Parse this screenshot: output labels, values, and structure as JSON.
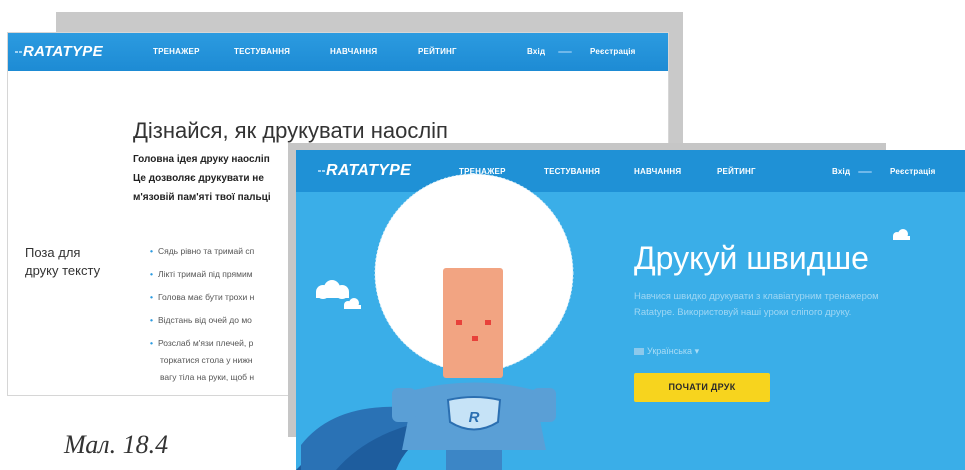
{
  "nav": {
    "logo": "RATATYPE",
    "items": [
      "ТРЕНАЖЕР",
      "ТЕСТУВАННЯ",
      "НАВЧАННЯ",
      "РЕЙТИНГ"
    ],
    "login": "Вхід",
    "register": "Реєстрація"
  },
  "back_page": {
    "title": "Дізнайся, як друкувати наосліп",
    "paragraph": [
      "Головна ідея друку наосліп",
      "Це дозволяє друкувати не",
      "м'язовій пам'яті твої пальці"
    ],
    "section_title": [
      "Поза для",
      "друку тексту"
    ],
    "bullets": [
      "Сядь рівно та тримай сп",
      "Лікті тримай під прямим",
      "Голова має бути трохи н",
      "Відстань від очей до мо",
      "Розслаб м'язи плечей, р"
    ],
    "bullet_continuation": [
      "торкатися стола у нижн",
      "вагу тіла на руки, щоб н"
    ]
  },
  "front_page": {
    "hero_title": "Друкуй швидше",
    "hero_subtitle": [
      "Навчися швидко друкувати з клавіатурним тренажером",
      "Ratatype. Використовуй наші уроки сліпого друку."
    ],
    "language": "Українська",
    "start_button": "ПОЧАТИ ДРУК",
    "badge_letter": "R"
  },
  "caption": "Мал. 18.4",
  "colors": {
    "nav": "#1f91d6",
    "hero_background": "#3aaee8",
    "button": "#f7d41e",
    "cape": "#1e5d9e",
    "face": "#f2a482"
  }
}
